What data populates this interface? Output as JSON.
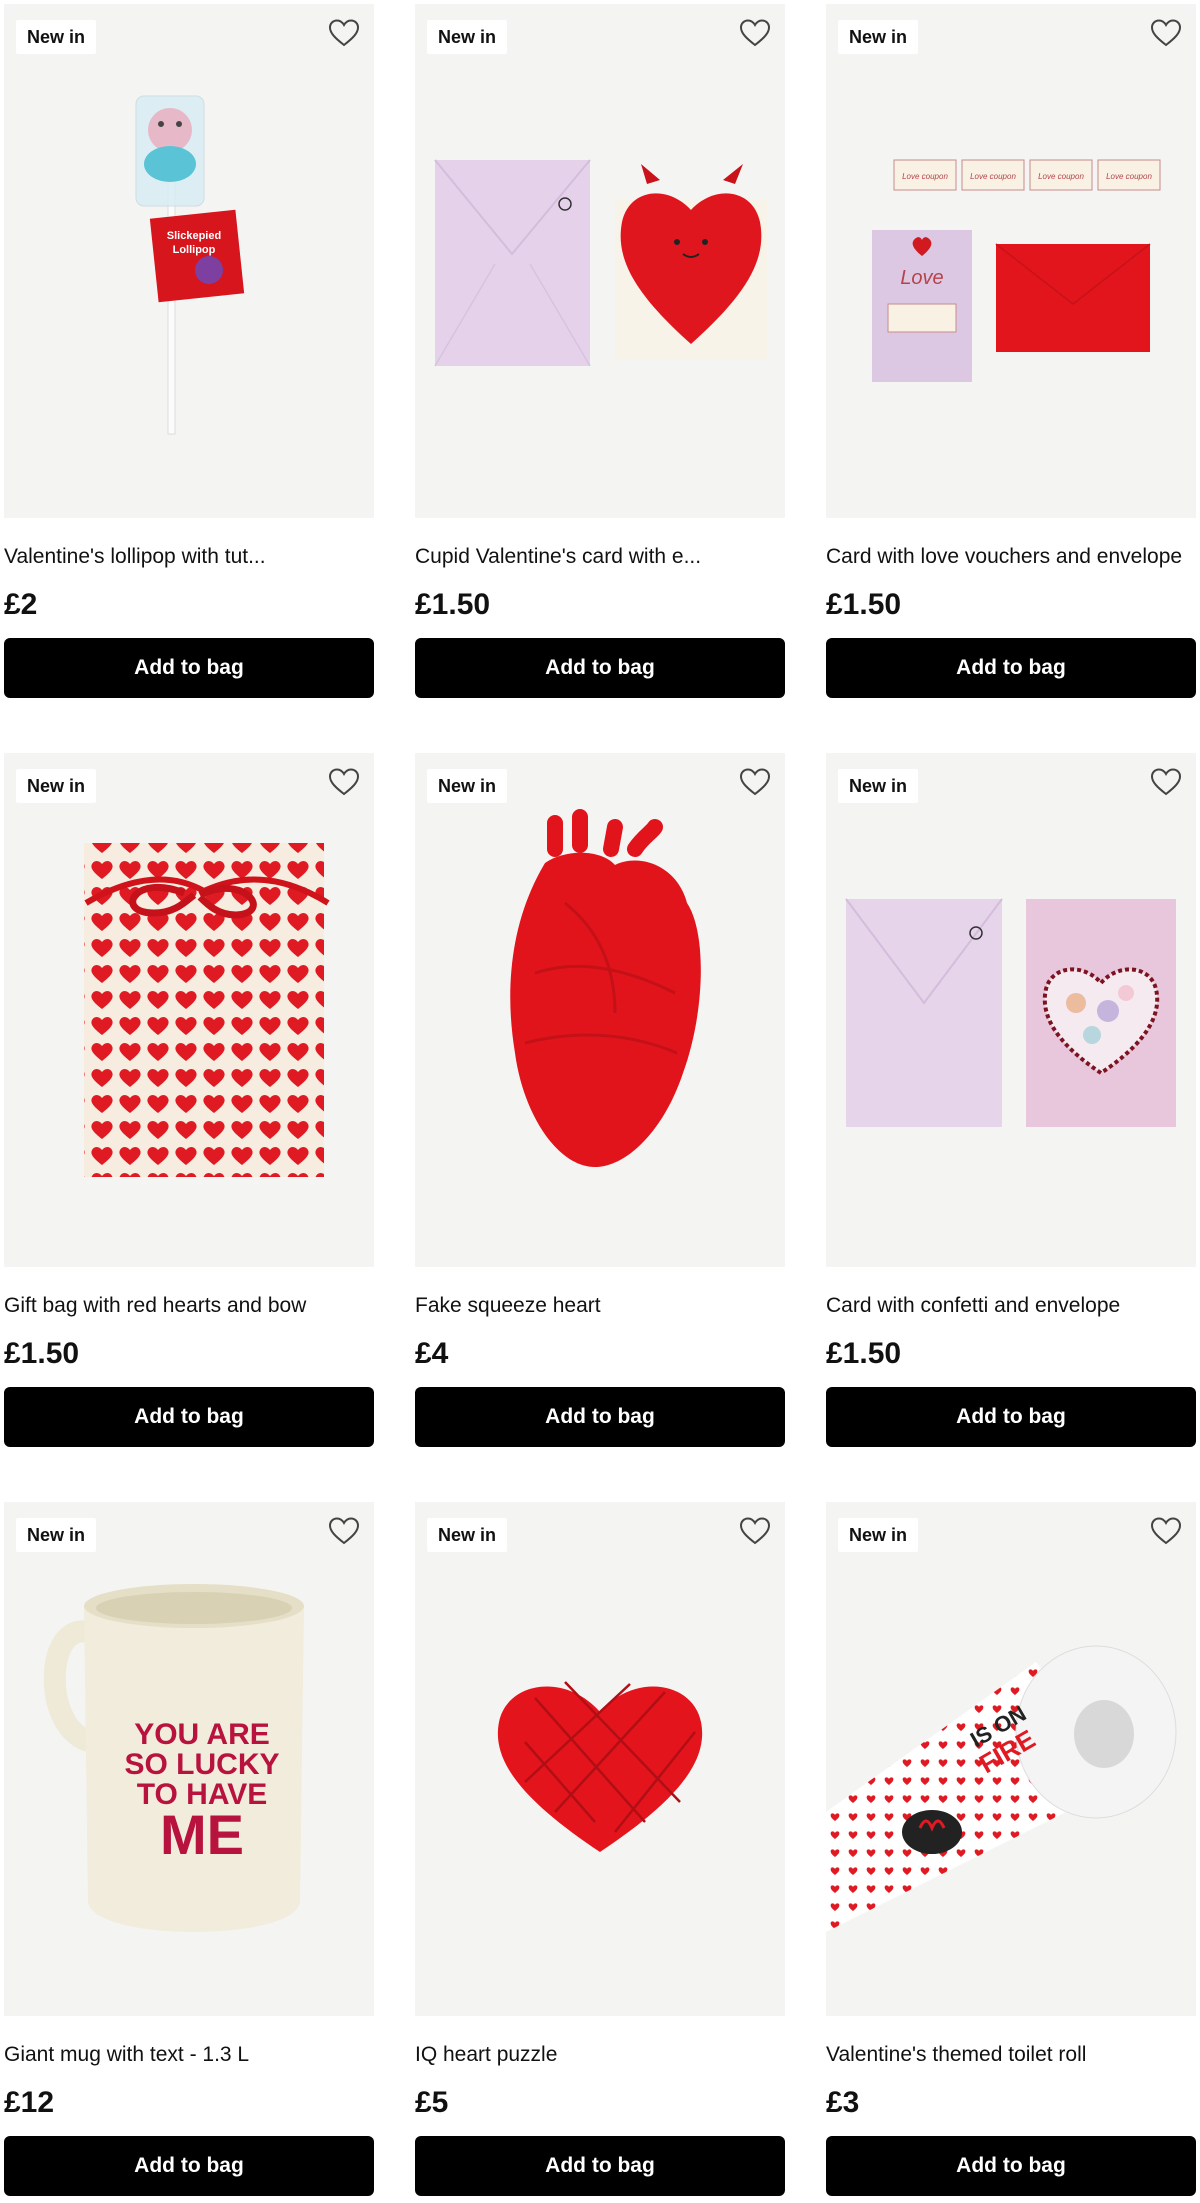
{
  "products": [
    {
      "badge": "New in",
      "title": "Valentine's lollipop with tut...",
      "price": "£2",
      "button": "Add to bag",
      "favorite_icon": "heart-outline-icon",
      "art": "lollipop",
      "art_text": {
        "tag_line1": "Slickepied",
        "tag_line2": "Lollipop"
      }
    },
    {
      "badge": "New in",
      "title": "Cupid Valentine's card with e...",
      "price": "£1.50",
      "button": "Add to bag",
      "favorite_icon": "heart-outline-icon",
      "art": "cupid-card"
    },
    {
      "badge": "New in",
      "title": "Card with love vouchers and envelope",
      "price": "£1.50",
      "button": "Add to bag",
      "favorite_icon": "heart-outline-icon",
      "art": "voucher-card",
      "art_text": {
        "voucher": "Love coupon",
        "card_word": "Love"
      }
    },
    {
      "badge": "New in",
      "title": "Gift bag with red hearts and bow",
      "price": "£1.50",
      "button": "Add to bag",
      "favorite_icon": "heart-outline-icon",
      "art": "gift-bag"
    },
    {
      "badge": "New in",
      "title": "Fake squeeze heart",
      "price": "£4",
      "button": "Add to bag",
      "favorite_icon": "heart-outline-icon",
      "art": "squeeze-heart"
    },
    {
      "badge": "New in",
      "title": "Card with confetti and envelope",
      "price": "£1.50",
      "button": "Add to bag",
      "favorite_icon": "heart-outline-icon",
      "art": "confetti-card"
    },
    {
      "badge": "New in",
      "title": "Giant mug with text - 1.3 L",
      "price": "£12",
      "button": "Add to bag",
      "favorite_icon": "heart-outline-icon",
      "art": "mug",
      "art_text": {
        "line1": "YOU ARE",
        "line2": "SO LUCKY",
        "line3": "TO HAVE",
        "line4": "ME"
      }
    },
    {
      "badge": "New in",
      "title": "IQ heart puzzle",
      "price": "£5",
      "button": "Add to bag",
      "favorite_icon": "heart-outline-icon",
      "art": "heart-puzzle"
    },
    {
      "badge": "New in",
      "title": "Valentine's themed toilet roll",
      "price": "£3",
      "button": "Add to bag",
      "favorite_icon": "heart-outline-icon",
      "art": "toilet-roll",
      "art_text": {
        "line1": "IS ON",
        "line2": "FIRE"
      }
    }
  ],
  "colors": {
    "tile_bg": "#f4f4f3",
    "accent_red": "#e01b22",
    "button_bg": "#000000",
    "lilac": "#e4d4ea"
  }
}
